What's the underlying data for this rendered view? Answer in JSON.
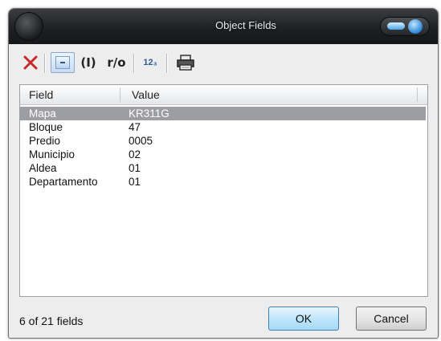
{
  "window": {
    "title": "Object Fields"
  },
  "toolbar": {
    "paren_label": "(I)",
    "readonly_label": "r/o",
    "numbering_label": "12₃",
    "icons": [
      "delete-x-icon",
      "minimize-field-icon",
      "printer-icon"
    ]
  },
  "list": {
    "columns": [
      "Field",
      "Value"
    ],
    "rows": [
      {
        "field": "Mapa",
        "value": "KR311G",
        "selected": true
      },
      {
        "field": "Bloque",
        "value": "47"
      },
      {
        "field": "Predio",
        "value": "0005"
      },
      {
        "field": "Municipio",
        "value": "02"
      },
      {
        "field": "Aldea",
        "value": "01"
      },
      {
        "field": "Departamento",
        "value": "01"
      }
    ]
  },
  "status": {
    "text": "6 of 21 fields"
  },
  "buttons": {
    "ok": "OK",
    "cancel": "Cancel"
  },
  "colors": {
    "selection": "#9d9ea3",
    "titlebar": "#1e2023",
    "ok_button": "#bee6fd",
    "delete_icon": "#c8282a"
  }
}
